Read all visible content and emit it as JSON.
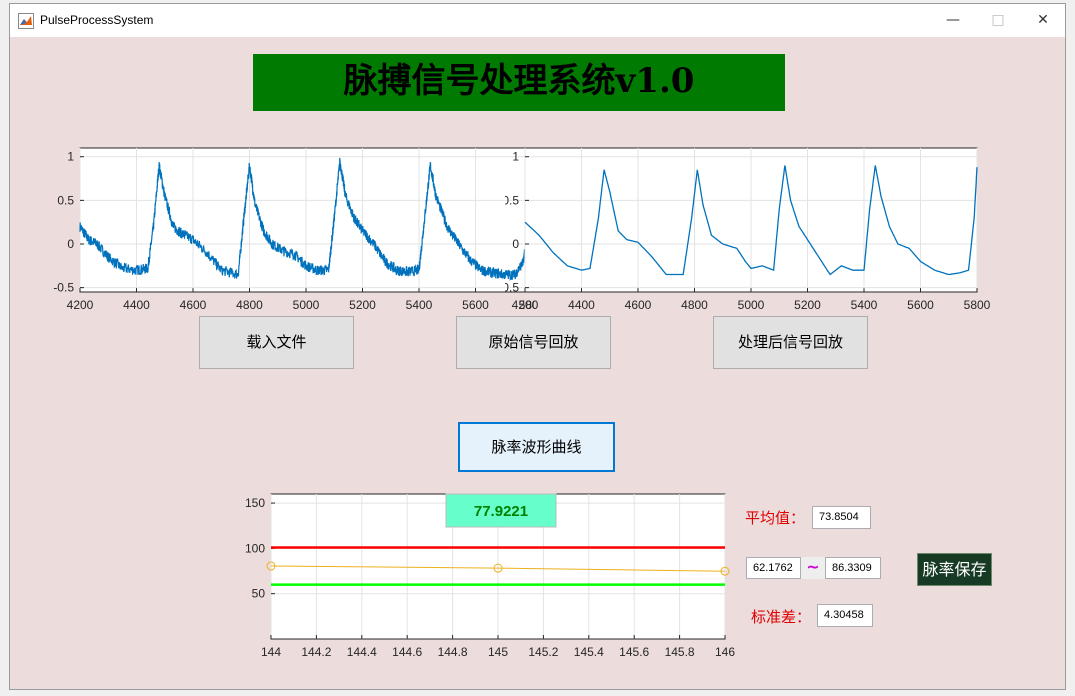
{
  "window": {
    "title": "PulseProcessSystem",
    "minimize": "—",
    "maximize": "□",
    "close": "✕"
  },
  "banner": {
    "text": "脉搏信号处理系统v1.0"
  },
  "buttons": {
    "load": "载入文件",
    "play_raw": "原始信号回放",
    "play_processed": "处理后信号回放",
    "pulse_curve": "脉率波形曲线",
    "save": "脉率保存"
  },
  "stats": {
    "mean_label": "平均值：",
    "mean_value": "73.8504",
    "range_low": "62.1762",
    "range_sep": "~",
    "range_high": "86.3309",
    "std_label": "标准差：",
    "std_value": "4.30458"
  },
  "chart_data": [
    {
      "type": "line",
      "x_ticks": [
        "4200",
        "4400",
        "4600",
        "4800",
        "5000",
        "5200",
        "5400",
        "5600",
        "5800"
      ],
      "y_ticks": [
        "-0.5",
        "0",
        "0.5",
        "1"
      ],
      "xlim": [
        4200,
        5800
      ],
      "ylim": [
        -0.55,
        1.1
      ],
      "grid": true,
      "color": "#0072bd",
      "noisy": true,
      "series": [
        {
          "x": [
            4200,
            4230,
            4260,
            4300,
            4350,
            4400,
            4440,
            4460,
            4480,
            4500,
            4530,
            4560,
            4600,
            4650,
            4700,
            4760,
            4780,
            4800,
            4820,
            4850,
            4880,
            4920,
            4960,
            5000,
            5040,
            5080,
            5100,
            5120,
            5140,
            5170,
            5200,
            5240,
            5280,
            5320,
            5360,
            5400,
            5420,
            5440,
            5460,
            5500,
            5540,
            5580,
            5620,
            5660,
            5700,
            5740,
            5770,
            5790,
            5800
          ],
          "y": [
            0.2,
            0.05,
            0.0,
            -0.15,
            -0.28,
            -0.3,
            -0.28,
            0.2,
            0.9,
            0.55,
            0.2,
            0.12,
            0.05,
            -0.1,
            -0.3,
            -0.35,
            0.3,
            0.9,
            0.45,
            0.15,
            0.0,
            -0.08,
            -0.12,
            -0.25,
            -0.3,
            -0.3,
            0.3,
            0.95,
            0.55,
            0.3,
            0.15,
            0.0,
            -0.2,
            -0.3,
            -0.32,
            -0.3,
            0.3,
            0.9,
            0.55,
            0.2,
            0.0,
            -0.18,
            -0.3,
            -0.33,
            -0.35,
            -0.35,
            -0.2,
            0.3,
            0.85
          ]
        }
      ]
    },
    {
      "type": "line",
      "x_ticks": [
        "4200",
        "4400",
        "4600",
        "4800",
        "5000",
        "5200",
        "5400",
        "5600",
        "5800"
      ],
      "y_ticks": [
        "-0.5",
        "0",
        "0.5",
        "1"
      ],
      "xlim": [
        4200,
        5800
      ],
      "ylim": [
        -0.55,
        1.1
      ],
      "grid": true,
      "color": "#0072bd",
      "noisy": false,
      "series": [
        {
          "x": [
            4200,
            4250,
            4300,
            4350,
            4400,
            4430,
            4460,
            4480,
            4500,
            4530,
            4560,
            4600,
            4650,
            4700,
            4760,
            4790,
            4810,
            4830,
            4860,
            4900,
            4950,
            4980,
            5000,
            5040,
            5080,
            5100,
            5120,
            5140,
            5170,
            5200,
            5240,
            5280,
            5320,
            5360,
            5400,
            5420,
            5440,
            5460,
            5490,
            5520,
            5560,
            5600,
            5650,
            5700,
            5740,
            5770,
            5790,
            5800
          ],
          "y": [
            0.25,
            0.1,
            -0.1,
            -0.25,
            -0.3,
            -0.28,
            0.3,
            0.85,
            0.6,
            0.15,
            0.05,
            0.02,
            -0.15,
            -0.35,
            -0.35,
            0.3,
            0.85,
            0.45,
            0.1,
            0.0,
            -0.05,
            -0.2,
            -0.28,
            -0.25,
            -0.3,
            0.4,
            0.9,
            0.5,
            0.2,
            0.05,
            -0.15,
            -0.35,
            -0.25,
            -0.3,
            -0.3,
            0.4,
            0.9,
            0.55,
            0.2,
            0.0,
            -0.05,
            -0.2,
            -0.3,
            -0.35,
            -0.33,
            -0.3,
            0.3,
            0.88
          ]
        }
      ]
    },
    {
      "type": "line",
      "x_ticks": [
        "144",
        "144.2",
        "144.4",
        "144.6",
        "144.8",
        "145",
        "145.2",
        "145.4",
        "145.6",
        "145.8",
        "146"
      ],
      "y_ticks": [
        "50",
        "100",
        "150"
      ],
      "xlim": [
        144,
        146
      ],
      "ylim": [
        0,
        160
      ],
      "grid": true,
      "series": [
        {
          "name": "",
          "x": [
            144,
            145,
            146
          ],
          "y": [
            80.5,
            78.2,
            74.8
          ],
          "color": "#edb120"
        }
      ],
      "hlines": [
        {
          "y": 101,
          "color": "#ff0000"
        },
        {
          "y": 60,
          "color": "#00ff00"
        }
      ],
      "annotation": {
        "text": "77.9221",
        "color": "#66ffcc",
        "text_color": "#008000"
      }
    }
  ]
}
